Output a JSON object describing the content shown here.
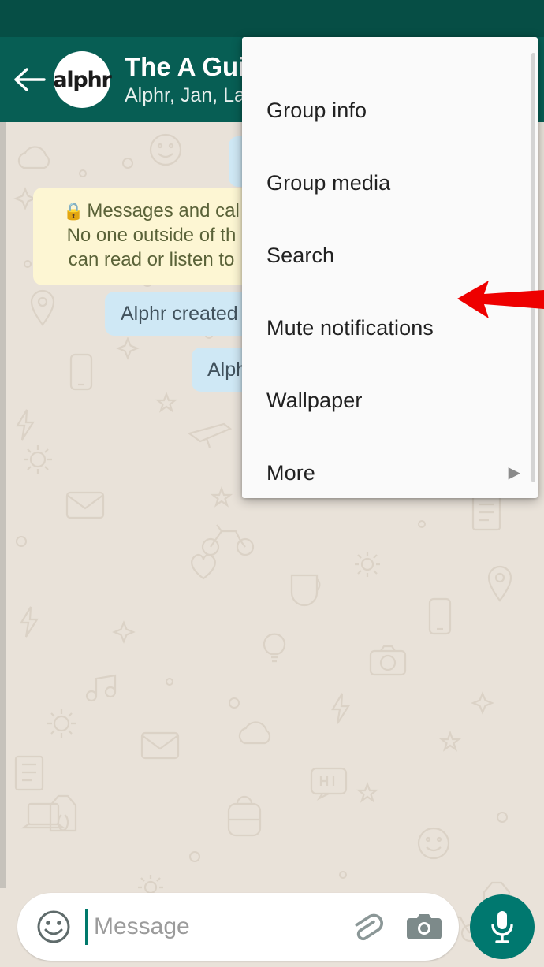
{
  "app": "WhatsApp",
  "colors": {
    "status_bar": "#064e45",
    "header_green": "#075e54",
    "accent_teal": "#00786f",
    "chat_background": "#e9e2d9",
    "system_bubble": "#cfe8f5",
    "encryption_bubble": "#fdf6d3",
    "menu_background": "#fafafa",
    "menu_text": "#212121",
    "annotation_red": "#ee0000"
  },
  "header": {
    "back_icon": "back-arrow-icon",
    "avatar_text": "alphr",
    "title": "The A Guid",
    "subtitle": "Alphr, Jan, Lady"
  },
  "messages": {
    "encryption_notice": {
      "lock_icon": "lock-icon",
      "line1": "Messages and cal",
      "line2": "No one outside of th",
      "line3": "can read or listen to"
    },
    "system_1": "Alphr created",
    "system_2": "Alph"
  },
  "overflow_menu": {
    "items": [
      {
        "label": "Group info",
        "has_submenu": false
      },
      {
        "label": "Group media",
        "has_submenu": false
      },
      {
        "label": "Search",
        "has_submenu": false
      },
      {
        "label": "Mute notifications",
        "has_submenu": false
      },
      {
        "label": "Wallpaper",
        "has_submenu": false
      },
      {
        "label": "More",
        "has_submenu": true,
        "caret": "▶"
      }
    ]
  },
  "annotation": {
    "type": "arrow",
    "points_to": "Mute notifications",
    "color": "#ee0000"
  },
  "input_bar": {
    "emoji_icon": "emoji-smiley-icon",
    "placeholder": "Message",
    "value": "",
    "attach_icon": "paperclip-icon",
    "camera_icon": "camera-icon",
    "mic_icon": "microphone-icon"
  }
}
